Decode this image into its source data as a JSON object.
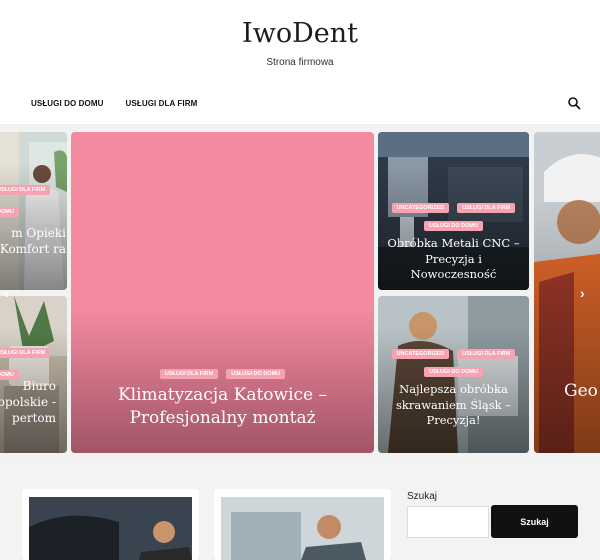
{
  "site": {
    "title": "IwoDent",
    "tagline": "Strona firmowa"
  },
  "nav": {
    "items": [
      {
        "label": "USŁUGI DO DOMU"
      },
      {
        "label": "USŁUGI DLA FIRM"
      }
    ],
    "search_icon": "search-icon"
  },
  "slider": {
    "cards": [
      {
        "tags": [
          "USŁUGI DLA FIRM",
          "DOMU"
        ],
        "title": "m Opieki Komfort ra"
      },
      {
        "tags": [
          "USŁUGI DLA FIRM",
          "DOMU"
        ],
        "title": "Biuro ałopolskie - pertom"
      },
      {
        "tags": [
          "USŁUGI DLA FIRM",
          "USŁUGI DO DOMU"
        ],
        "title": "Klimatyzacja Katowice – Profesjonalny montaż"
      },
      {
        "tags": [
          "UNCATEGORIZED",
          "USŁUGI DLA FIRM",
          "USŁUGI DO DOMU"
        ],
        "title": "Obróbka Metali CNC – Precyzja i Nowoczesność"
      },
      {
        "tags": [
          "UNCATEGORIZED",
          "USŁUGI DLA FIRM",
          "USŁUGI DO DOMU"
        ],
        "title": "Najlepsza obróbka skrawaniem Śląsk – Precyzja!"
      },
      {
        "tags": [],
        "title": "Geo"
      }
    ],
    "prev_icon": "chevron-left-icon",
    "next_icon": "chevron-right-icon"
  },
  "sidebar": {
    "search_label": "Szukaj",
    "search_value": "",
    "search_button": "Szukaj"
  },
  "colors": {
    "tag_bg": "#f5a3b3",
    "featured_bg": "#f48aa0",
    "button_bg": "#111111"
  }
}
